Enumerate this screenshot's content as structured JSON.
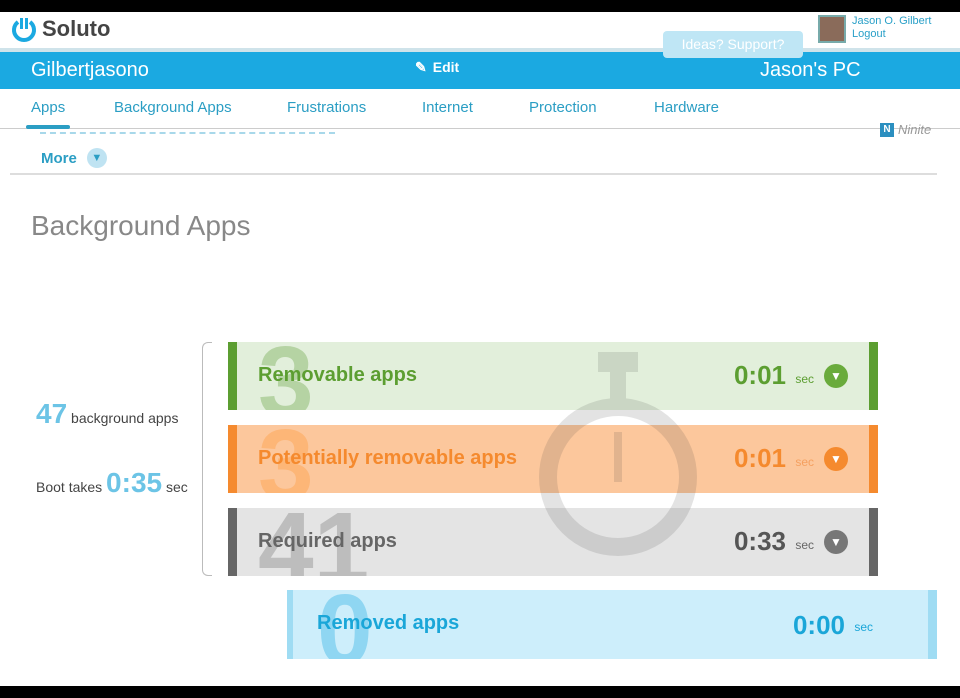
{
  "header": {
    "logo": "Soluto",
    "user_name": "Jason O. Gilbert",
    "logout": "Logout",
    "support": "Ideas? Support?"
  },
  "bar": {
    "username": "Gilbertjasono",
    "edit": "Edit",
    "pc_name": "Jason's PC"
  },
  "nav": {
    "items": [
      "Apps",
      "Background Apps",
      "Frustrations",
      "Internet",
      "Protection",
      "Hardware"
    ],
    "active": "Apps"
  },
  "more": "More",
  "ninite": "Ninite",
  "page_title": "Background Apps",
  "summary": {
    "count": "47",
    "count_label": "background apps",
    "boot_label": "Boot takes",
    "boot_time": "0:35",
    "boot_unit": "sec"
  },
  "rows": [
    {
      "count": "3",
      "name": "Removable apps",
      "time": "0:01",
      "unit": "sec",
      "color": "#5c9e31"
    },
    {
      "count": "3",
      "name": "Potentially removable apps",
      "time": "0:01",
      "unit": "sec",
      "color": "#f58a2e"
    },
    {
      "count": "41",
      "name": "Required apps",
      "time": "0:33",
      "unit": "sec",
      "color": "#666666"
    },
    {
      "count": "0",
      "name": "Removed apps",
      "time": "0:00",
      "unit": "sec",
      "color": "#1aa6d8"
    }
  ]
}
